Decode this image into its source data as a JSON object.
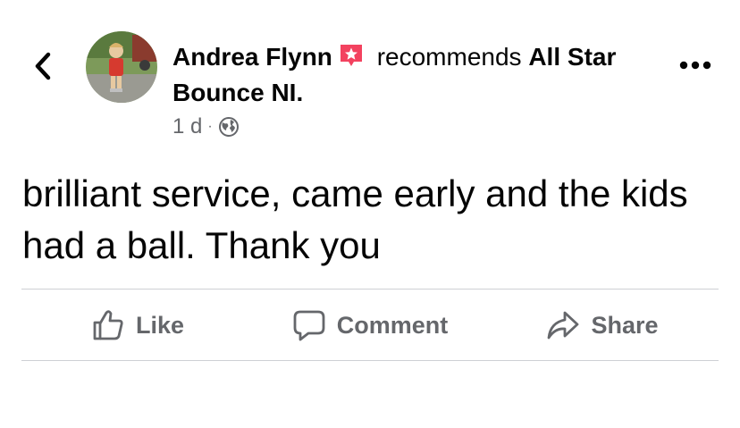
{
  "post": {
    "author": "Andrea Flynn",
    "verb": "recommends",
    "page_name": "All Star Bounce NI.",
    "time": "1 d",
    "separator": "·",
    "audience_icon": "globe-icon",
    "recommend_icon": "star-badge-icon",
    "text": "brilliant service, came early and the kids had a ball. Thank you"
  },
  "actions": {
    "like": "Like",
    "comment": "Comment",
    "share": "Share"
  },
  "colors": {
    "text": "#050505",
    "secondary": "#65676b",
    "badge": "#f3425f",
    "divider": "#ced0d4"
  }
}
